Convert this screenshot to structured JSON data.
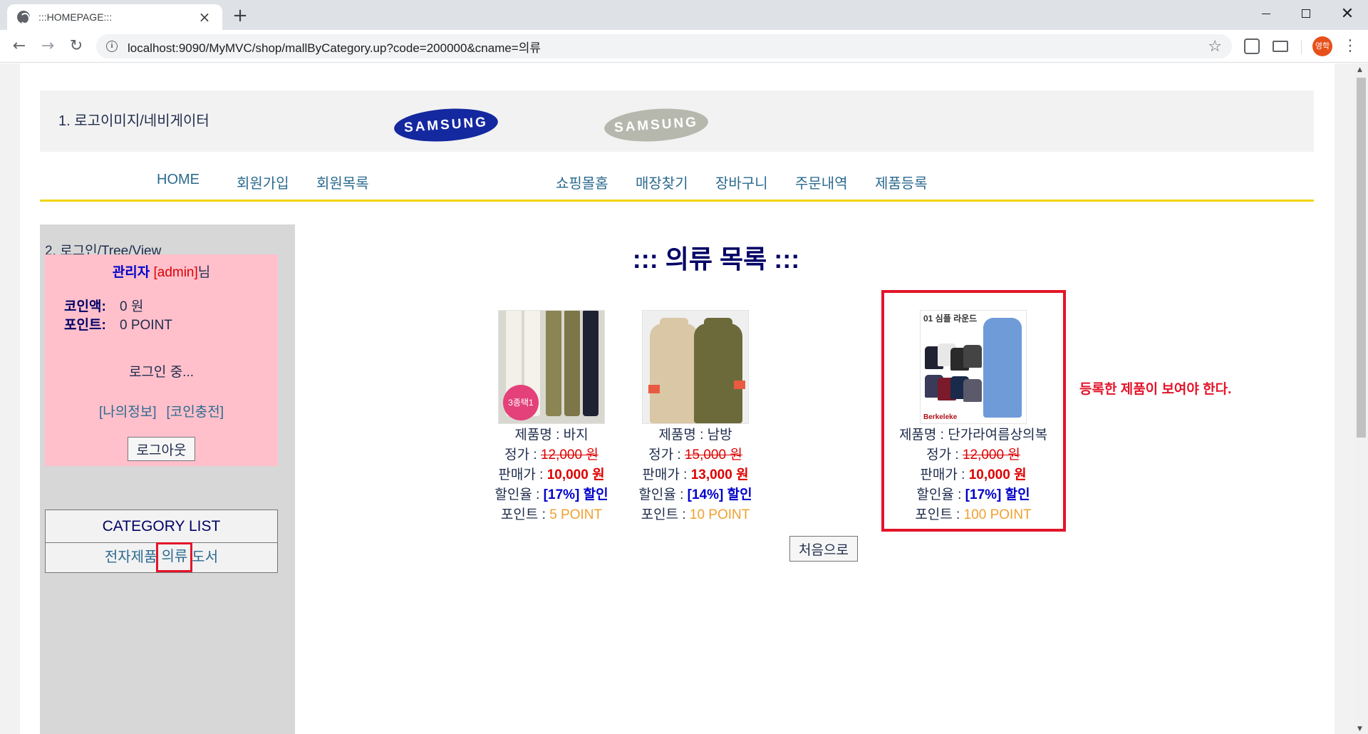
{
  "browser": {
    "tab_title": ":::HOMEPAGE:::",
    "url": "localhost:9090/MyMVC/shop/mallByCategory.up?code=200000&cname=의류",
    "profile_initials": "영학"
  },
  "header": {
    "label": "1. 로고이미지/네비게이터",
    "logo_text_1": "SAMSUNG",
    "logo_text_2": "SAMSUNG"
  },
  "nav": {
    "items": [
      "HOME",
      "회원가입",
      "회원목록",
      "쇼핑몰홈",
      "매장찾기",
      "장바구니",
      "주문내역",
      "제품등록"
    ]
  },
  "sidebar": {
    "label": "2. 로그인/Tree/View",
    "greeting_role": "관리자",
    "greeting_id": "[admin]",
    "greeting_suffix": "님",
    "coin_label": "코인액:",
    "coin_value": "0 원",
    "point_label": "포인트:",
    "point_value": "0 POINT",
    "status": "로그인 중...",
    "link_myinfo": "[나의정보]",
    "link_charge": "[코인충전]",
    "logout_button": "로그아웃",
    "category_title": "CATEGORY LIST",
    "categories": [
      "전자제품",
      "의류",
      "도서"
    ]
  },
  "content": {
    "title": "::: 의류 목록 :::",
    "note": "등록한 제품이 보여야 한다.",
    "home_button": "처음으로",
    "labels": {
      "name": "제품명 : ",
      "price": "정가 : ",
      "sale": "판매가 : ",
      "discount": "할인율 : ",
      "point": "포인트 : "
    },
    "products": [
      {
        "name": "바지",
        "price": "12,000 원",
        "sale": "10,000 원",
        "discount": "[17%] 할인",
        "point": "5 POINT",
        "badge": "3종택1"
      },
      {
        "name": "남방",
        "price": "15,000 원",
        "sale": "13,000 원",
        "discount": "[14%] 할인",
        "point": "10 POINT"
      },
      {
        "name": "단가라여름상의복",
        "price": "12,000 원",
        "sale": "10,000 원",
        "discount": "[17%] 할인",
        "point": "100 POINT",
        "image_text": "01 심플 라운드",
        "image_brand": "Berkeleke"
      }
    ]
  },
  "colors": {
    "accent_red": "#e3152a",
    "nav_underline": "#f2d50f",
    "login_bg": "#ffc0cb",
    "samsung_blue": "#1428a0"
  }
}
